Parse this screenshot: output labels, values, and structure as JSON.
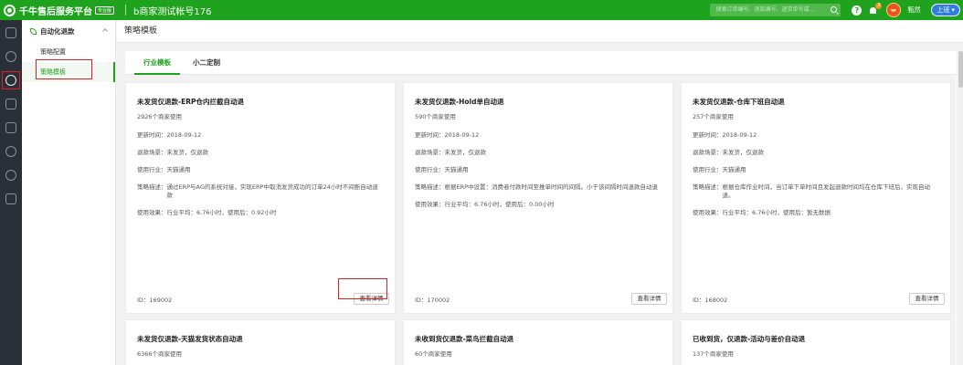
{
  "header": {
    "logo_text": "千牛售后服务平台",
    "logo_badge": "专业版",
    "account": "b商家测试帐号176",
    "search_placeholder": "搜索订单编号、退款编号、退货单号或...",
    "help_glyph": "?",
    "bell_count": "3",
    "username": "甄然",
    "top_button": "上班",
    "top_button_icon": "chevron-down-icon",
    "brand_color": "#1fa21d"
  },
  "rail": {
    "icons": [
      "home-icon",
      "money-icon",
      "refund-shield-icon",
      "list-icon",
      "ticket-icon",
      "clock-icon",
      "users-icon",
      "calendar-icon"
    ],
    "active": "refund-shield-icon"
  },
  "subnav": {
    "group": "自动化退款",
    "items": [
      {
        "label": "策略配置",
        "active": false
      },
      {
        "label": "策略模板",
        "active": true
      }
    ]
  },
  "page": {
    "title": "策略模板",
    "tabs": [
      {
        "label": "行业模板",
        "active": true
      },
      {
        "label": "小二定制",
        "active": false
      }
    ]
  },
  "cards": [
    {
      "title": "未发货仅退款-ERP仓内拦截自动退",
      "usage": "2926个商家使用",
      "update": "更新时间：2018-09-12",
      "scene": "退款场景：未发货，仅退款",
      "industry": "使用行业：天猫通用",
      "desc_label": "策略描述：",
      "desc": "通过ERP与AG的系统对接，实现ERP中取消发货成功的订单24小时不间断自动退款",
      "effect": "使用效果：行业平均：6.76小时，使用后：0.92小时",
      "id": "ID：169002",
      "button": "查看详情"
    },
    {
      "title": "未发货仅退款-Hold单自动退",
      "usage": "590个商家使用",
      "update": "更新时间：2018-09-12",
      "scene": "退款场景：未发货，仅退款",
      "industry": "使用行业：天猫通用",
      "desc_label": "策略描述：",
      "desc": "根据ERP中设置：消费者付款时间至推单时间的间隔。小于该间隔时间退款自动退",
      "effect": "使用效果：行业平均：6.76小时，使用后：0.00小时",
      "id": "ID：170002",
      "button": "查看详情"
    },
    {
      "title": "未发货仅退款-仓库下班自动退",
      "usage": "257个商家使用",
      "update": "更新时间：2018-09-12",
      "scene": "退款场景：未发货，仅退款",
      "industry": "使用行业：天猫通用",
      "desc_label": "策略描述：",
      "desc": "根据仓库作业时间，当订单下单时间且发起退款时间均在仓库下班后，实现自动退。",
      "effect": "使用效果：行业平均：6.76小时，使用后：暂无数据",
      "id": "ID：168002",
      "button": "查看详情"
    },
    {
      "title": "未发货仅退款-天猫发货状态自动退",
      "usage": "6366个商家使用"
    },
    {
      "title": "未收到货仅退款-菜鸟拦截自动退",
      "usage": "60个商家使用"
    },
    {
      "title": "已收到货，仅退款-活动与差价自动退",
      "usage": "137个商家使用"
    }
  ]
}
